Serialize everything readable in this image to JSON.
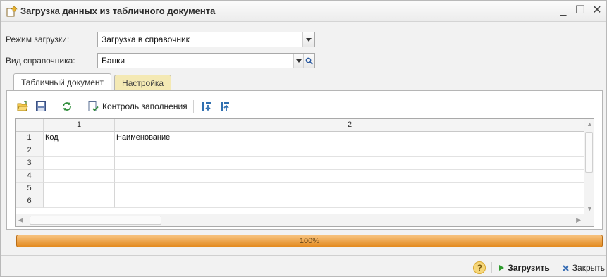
{
  "window": {
    "title": "Загрузка данных из табличного документа",
    "controls": {
      "minimize": "_",
      "maximize": "☐",
      "close": "✕"
    }
  },
  "form": {
    "mode_label": "Режим загрузки:",
    "mode_value": "Загрузка в справочник",
    "catalog_label": "Вид справочника:",
    "catalog_value": "Банки"
  },
  "tabs": [
    {
      "label": "Табличный документ",
      "active": true
    },
    {
      "label": "Настройка",
      "active": false
    }
  ],
  "toolbar": {
    "fill_control_label": "Контроль заполнения"
  },
  "grid": {
    "column_headers": [
      "1",
      "2"
    ],
    "rows": [
      {
        "num": "1",
        "cells": [
          "Код",
          "Наименование"
        ]
      },
      {
        "num": "2",
        "cells": [
          "",
          ""
        ]
      },
      {
        "num": "3",
        "cells": [
          "",
          ""
        ]
      },
      {
        "num": "4",
        "cells": [
          "",
          ""
        ]
      },
      {
        "num": "5",
        "cells": [
          "",
          ""
        ]
      },
      {
        "num": "6",
        "cells": [
          "",
          ""
        ]
      }
    ]
  },
  "progress": {
    "text": "100%",
    "value": 1.0
  },
  "footer": {
    "help_label": "?",
    "load_label": "Загрузить",
    "close_label": "Закрыть"
  },
  "colors": {
    "progress_orange": "#e38a1f",
    "tab_inactive": "#f4e9b4",
    "load_green": "#2e9b2e",
    "close_blue": "#3a6fb5"
  }
}
